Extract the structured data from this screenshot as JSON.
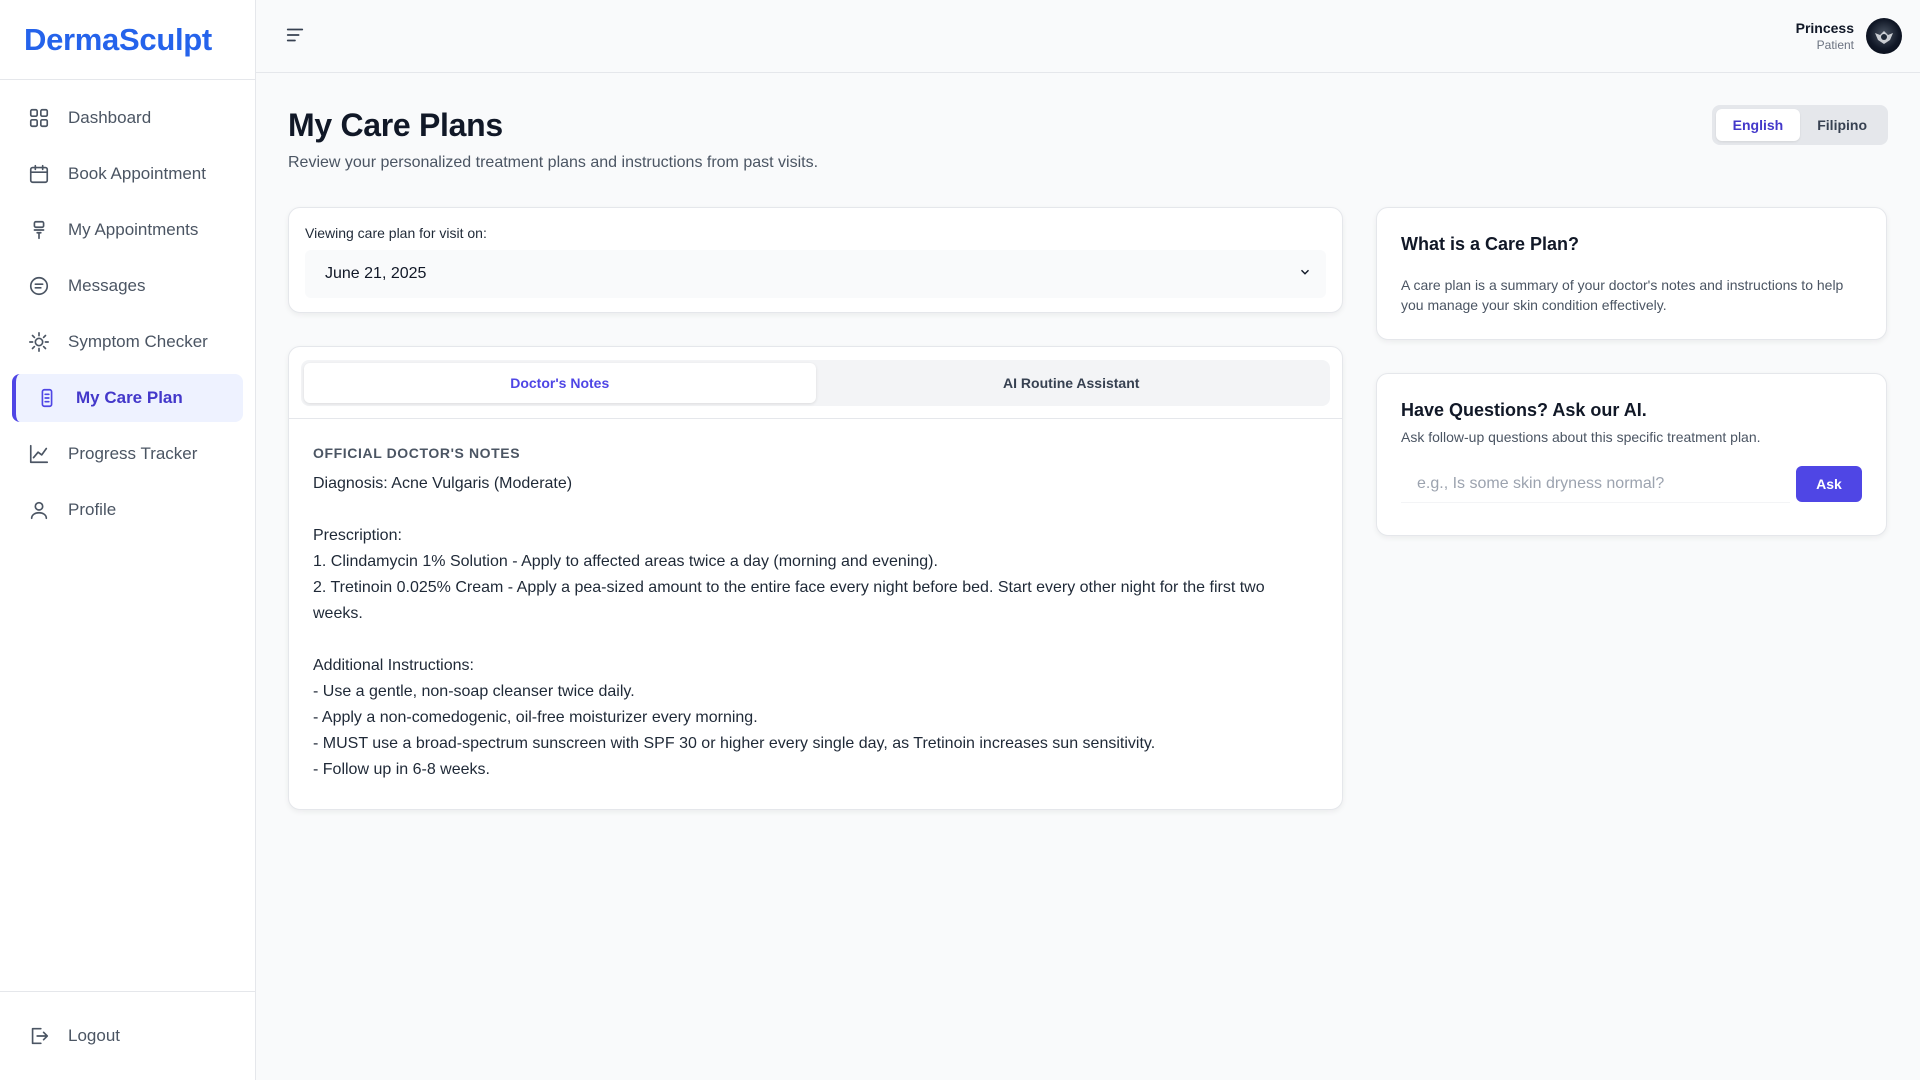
{
  "app": {
    "brand": "DermaSculpt"
  },
  "sidebar": {
    "items": [
      {
        "label": "Dashboard",
        "icon": "grid-icon"
      },
      {
        "label": "Book Appointment",
        "icon": "calendar-icon"
      },
      {
        "label": "My Appointments",
        "icon": "appointments-icon"
      },
      {
        "label": "Messages",
        "icon": "message-icon"
      },
      {
        "label": "Symptom Checker",
        "icon": "sun-icon"
      },
      {
        "label": "My Care Plan",
        "icon": "clipboard-icon",
        "active": true
      },
      {
        "label": "Progress Tracker",
        "icon": "chart-line-icon"
      },
      {
        "label": "Profile",
        "icon": "user-icon"
      }
    ],
    "logout_label": "Logout"
  },
  "header": {
    "user_name": "Princess",
    "user_role": "Patient"
  },
  "page": {
    "title": "My Care Plans",
    "subtitle": "Review your personalized treatment plans and instructions from past visits.",
    "languages": [
      "English",
      "Filipino"
    ],
    "active_language": "English"
  },
  "visit": {
    "label": "Viewing care plan for visit on:",
    "selected": "June 21, 2025"
  },
  "tabs": {
    "doctor_notes": "Doctor's Notes",
    "ai_assistant": "AI Routine Assistant",
    "active": "Doctor's Notes"
  },
  "notes": {
    "heading": "Official Doctor's Notes",
    "body": "Diagnosis: Acne Vulgaris (Moderate)\n\nPrescription:\n1. Clindamycin 1% Solution - Apply to affected areas twice a day (morning and evening).\n2. Tretinoin 0.025% Cream - Apply a pea-sized amount to the entire face every night before bed. Start every other night for the first two weeks.\n\nAdditional Instructions:\n- Use a gentle, non-soap cleanser twice daily.\n- Apply a non-comedogenic, oil-free moisturizer every morning.\n- MUST use a broad-spectrum sunscreen with SPF 30 or higher every single day, as Tretinoin increases sun sensitivity.\n- Follow up in 6-8 weeks."
  },
  "info": {
    "title": "What is a Care Plan?",
    "text": "A care plan is a summary of your doctor's notes and instructions to help you manage your skin condition effectively."
  },
  "ask": {
    "title": "Have Questions? Ask our AI.",
    "subtitle": "Ask follow-up questions about this specific treatment plan.",
    "placeholder": "e.g., Is some skin dryness normal?",
    "button_label": "Ask"
  },
  "colors": {
    "brand": "#2563eb",
    "accent": "#4f46e5",
    "active_bg": "#eef2ff"
  }
}
